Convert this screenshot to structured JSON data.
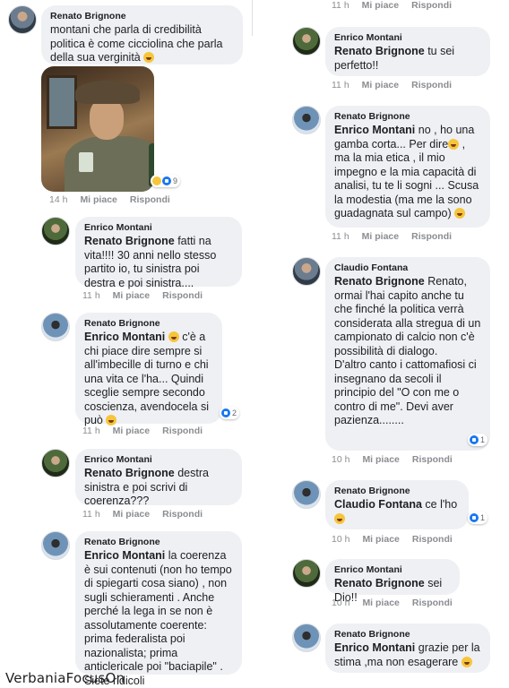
{
  "labels": {
    "like": "Mi piace",
    "reply": "Rispondi"
  },
  "left": [
    {
      "author": "Renato Brignone",
      "mention": "",
      "text": "montani che parla di credibilità politica è come cicciolina che parla della sua verginità",
      "emoji": true,
      "time": "14 h",
      "reaction_count": "9",
      "has_image": true
    },
    {
      "author": "Enrico Montani",
      "mention": "Renato Brignone",
      "text": "fatti na vita!!!! 30 anni nello stesso partito io, tu sinistra poi destra e poi sinistra....",
      "emoji": false,
      "time": "11 h"
    },
    {
      "author": "Renato Brignone",
      "mention": "Enrico Montani",
      "text": "c'è a chi piace dire sempre si all'imbecille di turno e chi una vita ce l'ha... Quindi sceglie sempre secondo coscienza, avendocela si può",
      "emoji": true,
      "time": "11 h",
      "reaction_count": "2"
    },
    {
      "author": "Enrico Montani",
      "mention": "Renato Brignone",
      "text": "destra sinistra e poi scrivi di coerenza???",
      "emoji": false,
      "time": "11 h"
    },
    {
      "author": "Renato Brignone",
      "mention": "Enrico Montani",
      "text": "la coerenza è sui contenuti (non ho tempo di spiegarti cosa siano) , non sugli schieramenti . Anche perché la lega in se non è assolutamente coerente: prima federalista poi nazionalista; prima anticlericale poi \"baciapile\" . Siete ridicoli",
      "emoji": false
    }
  ],
  "right": [
    {
      "time_top": "11 h"
    },
    {
      "author": "Enrico Montani",
      "mention": "Renato Brignone",
      "text": "tu sei perfetto!!",
      "emoji": false,
      "time": "11 h"
    },
    {
      "author": "Renato Brignone",
      "mention": "Enrico Montani",
      "text_a": "no , ho una gamba corta... Per dire",
      "text_b": ", ma la mia etica , il mio impegno e la mia capacità di analisi, tu te li sogni ... Scusa la modestia (ma me la sono guadagnata sul campo)",
      "time": "11 h"
    },
    {
      "author": "Claudio Fontana",
      "mention": "Renato Brignone",
      "text": "Renato, ormai l'hai capito anche tu che finché la politica verrà considerata alla stregua di un campionato di calcio non c'è possibilità di dialogo.",
      "text2": "D'altro canto i cattomafiosi ci insegnano da secoli il principio del \"O con me o contro di me\". Devi aver pazienza........",
      "time": "10 h",
      "reaction_count": "1"
    },
    {
      "author": "Renato Brignone",
      "mention": "Claudio Fontana",
      "text": "ce l'ho",
      "emoji": true,
      "time": "10 h",
      "reaction_count": "1"
    },
    {
      "author": "Enrico Montani",
      "mention": "Renato Brignone",
      "text": "sei Dio!!",
      "emoji": false,
      "time": "10 h"
    },
    {
      "author": "Renato Brignone",
      "mention": "Enrico Montani",
      "text": "grazie per la stima ,ma non esagerare",
      "emoji": true
    }
  ],
  "watermark": "VerbaniaFocusOn"
}
